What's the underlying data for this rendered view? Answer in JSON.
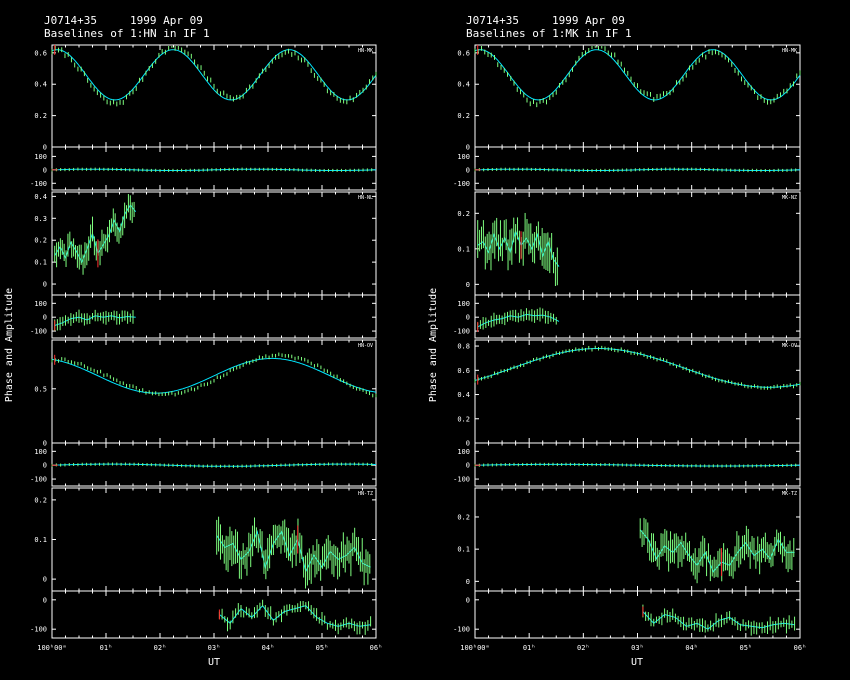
{
  "chart_data": [
    {
      "type": "line",
      "source": "J0714+35",
      "date": "1999 Apr 09",
      "subtitle": "Baselines of 1:HN in IF 1",
      "ylabel": "Phase and Amplitude",
      "xlabel": "UT",
      "x_ticks": [
        "100ʰ00ᵐ",
        "01ʰ",
        "02ʰ",
        "03ʰ",
        "04ʰ",
        "05ʰ",
        "06ʰ"
      ],
      "x_range_hours": [
        0,
        6
      ],
      "baselines": [
        {
          "name": "HN-MK",
          "amp_ylim": [
            0,
            0.65
          ],
          "amp_ticks": [
            0,
            0.2,
            0.4,
            0.6
          ],
          "phase_ylim": [
            -150,
            170
          ],
          "phase_ticks": [
            -100,
            0,
            100
          ],
          "model": {
            "base": 0.46,
            "amp": 0.16,
            "period_h": 2.15,
            "phase_rad": 1.3
          },
          "data_offset": -0.025,
          "noise": 0.015,
          "data_start_h": 0,
          "data_end_h": 6,
          "phase_model": {
            "amp": 5,
            "period_h": 3
          },
          "phase_noise": 3,
          "phase_extent_h": [
            0,
            6
          ]
        },
        {
          "name": "HN-NL",
          "amp_ylim": [
            -0.05,
            0.42
          ],
          "amp_ticks": [
            0,
            0.1,
            0.2,
            0.3,
            0.4
          ],
          "phase_ylim": [
            -150,
            160
          ],
          "phase_ticks": [
            -100,
            0,
            100
          ],
          "data": [
            [
              0.05,
              0.13
            ],
            [
              0.15,
              0.17
            ],
            [
              0.25,
              0.12
            ],
            [
              0.35,
              0.19
            ],
            [
              0.45,
              0.15
            ],
            [
              0.55,
              0.1
            ],
            [
              0.65,
              0.16
            ],
            [
              0.75,
              0.23
            ],
            [
              0.85,
              0.14
            ],
            [
              0.95,
              0.18
            ],
            [
              1.05,
              0.22
            ],
            [
              1.15,
              0.29
            ],
            [
              1.25,
              0.24
            ],
            [
              1.35,
              0.32
            ],
            [
              1.45,
              0.36
            ],
            [
              1.55,
              0.33
            ]
          ],
          "noise": 0.06,
          "phase_data": [
            [
              0.05,
              -60
            ],
            [
              0.2,
              -40
            ],
            [
              0.35,
              -10
            ],
            [
              0.5,
              0
            ],
            [
              0.65,
              -20
            ],
            [
              0.8,
              10
            ],
            [
              0.95,
              0
            ],
            [
              1.1,
              10
            ],
            [
              1.25,
              -5
            ],
            [
              1.4,
              5
            ],
            [
              1.55,
              0
            ]
          ],
          "phase_noise": 20
        },
        {
          "name": "HN-OV",
          "amp_ylim": [
            0,
            0.95
          ],
          "amp_ticks": [
            0,
            0.5
          ],
          "phase_ylim": [
            -150,
            160
          ],
          "phase_ticks": [
            -100,
            0,
            100
          ],
          "model": {
            "base": 0.62,
            "amp": 0.16,
            "period_h": 4.3,
            "phase_rad": 1.9
          },
          "data_offset": 0.04,
          "noise": 0.012,
          "data_start_h": 0,
          "data_end_h": 6,
          "phase_model": {
            "amp": 8,
            "period_h": 4.3
          },
          "phase_noise": 3,
          "phase_extent_h": [
            0,
            6
          ]
        },
        {
          "name": "HN-TZ",
          "amp_ylim": [
            -0.03,
            0.23
          ],
          "amp_ticks": [
            0,
            0.1,
            0.2
          ],
          "phase_ylim": [
            -130,
            30
          ],
          "phase_ticks": [
            -100,
            0
          ],
          "data": [
            [
              3.05,
              0.11
            ],
            [
              3.2,
              0.08
            ],
            [
              3.35,
              0.09
            ],
            [
              3.5,
              0.05
            ],
            [
              3.65,
              0.07
            ],
            [
              3.8,
              0.12
            ],
            [
              3.95,
              0.03
            ],
            [
              4.1,
              0.09
            ],
            [
              4.25,
              0.12
            ],
            [
              4.4,
              0.06
            ],
            [
              4.55,
              0.1
            ],
            [
              4.7,
              0.02
            ],
            [
              4.85,
              0.06
            ],
            [
              5.0,
              0.03
            ],
            [
              5.15,
              0.07
            ],
            [
              5.3,
              0.05
            ],
            [
              5.45,
              0.06
            ],
            [
              5.6,
              0.08
            ],
            [
              5.75,
              0.04
            ],
            [
              5.9,
              0.03
            ]
          ],
          "noise": 0.045,
          "phase_data": [
            [
              3.1,
              -50
            ],
            [
              3.3,
              -80
            ],
            [
              3.5,
              -30
            ],
            [
              3.7,
              -60
            ],
            [
              3.9,
              -20
            ],
            [
              4.1,
              -70
            ],
            [
              4.3,
              -40
            ],
            [
              4.5,
              -30
            ],
            [
              4.7,
              -20
            ],
            [
              4.9,
              -60
            ],
            [
              5.1,
              -80
            ],
            [
              5.3,
              -90
            ],
            [
              5.5,
              -80
            ],
            [
              5.7,
              -90
            ],
            [
              5.9,
              -85
            ]
          ],
          "phase_noise": 25
        }
      ]
    },
    {
      "type": "line",
      "source": "J0714+35",
      "date": "1999 Apr 09",
      "subtitle": "Baselines of 1:MK in IF 1",
      "ylabel": "Phase and Amplitude",
      "xlabel": "UT",
      "x_ticks": [
        "100ʰ00ᵐ",
        "01ʰ",
        "02ʰ",
        "03ʰ",
        "04ʰ",
        "05ʰ",
        "06ʰ"
      ],
      "x_range_hours": [
        0,
        6
      ],
      "baselines": [
        {
          "name": "HN-MK",
          "amp_ylim": [
            0,
            0.65
          ],
          "amp_ticks": [
            0,
            0.2,
            0.4,
            0.6
          ],
          "phase_ylim": [
            -150,
            170
          ],
          "phase_ticks": [
            -100,
            0,
            100
          ],
          "model": {
            "base": 0.46,
            "amp": 0.16,
            "period_h": 2.15,
            "phase_rad": 1.3
          },
          "data_offset": -0.025,
          "noise": 0.015,
          "data_start_h": 0,
          "data_end_h": 6,
          "phase_model": {
            "amp": 5,
            "period_h": 3
          },
          "phase_noise": 3,
          "phase_extent_h": [
            0,
            6
          ]
        },
        {
          "name": "MK-NZ",
          "amp_ylim": [
            -0.03,
            0.26
          ],
          "amp_ticks": [
            0,
            0.1,
            0.2
          ],
          "phase_ylim": [
            -150,
            160
          ],
          "phase_ticks": [
            -100,
            0,
            100
          ],
          "data": [
            [
              0.05,
              0.11
            ],
            [
              0.15,
              0.12
            ],
            [
              0.25,
              0.09
            ],
            [
              0.35,
              0.14
            ],
            [
              0.45,
              0.1
            ],
            [
              0.55,
              0.13
            ],
            [
              0.65,
              0.09
            ],
            [
              0.75,
              0.15
            ],
            [
              0.85,
              0.11
            ],
            [
              0.95,
              0.13
            ],
            [
              1.05,
              0.1
            ],
            [
              1.15,
              0.14
            ],
            [
              1.25,
              0.08
            ],
            [
              1.35,
              0.12
            ],
            [
              1.45,
              0.07
            ],
            [
              1.55,
              0.05
            ]
          ],
          "noise": 0.055,
          "phase_data": [
            [
              0.05,
              -70
            ],
            [
              0.2,
              -40
            ],
            [
              0.35,
              -20
            ],
            [
              0.5,
              -10
            ],
            [
              0.65,
              10
            ],
            [
              0.8,
              0
            ],
            [
              0.95,
              20
            ],
            [
              1.1,
              10
            ],
            [
              1.25,
              15
            ],
            [
              1.4,
              0
            ],
            [
              1.55,
              -30
            ]
          ],
          "phase_noise": 25
        },
        {
          "name": "MK-OV",
          "amp_ylim": [
            0,
            0.85
          ],
          "amp_ticks": [
            0,
            0.2,
            0.4,
            0.6,
            0.8
          ],
          "phase_ylim": [
            -150,
            160
          ],
          "phase_ticks": [
            -100,
            0,
            100
          ],
          "model": {
            "base": 0.62,
            "amp": 0.16,
            "period_h": 6.3,
            "phase_rad": -0.7
          },
          "data_offset": 0,
          "noise": 0.01,
          "data_start_h": 0,
          "data_end_h": 6,
          "phase_model": {
            "amp": 6,
            "period_h": 6
          },
          "phase_noise": 3,
          "phase_extent_h": [
            0,
            6
          ]
        },
        {
          "name": "MK-TZ",
          "amp_ylim": [
            -0.03,
            0.29
          ],
          "amp_ticks": [
            0,
            0.1,
            0.2
          ],
          "phase_ylim": [
            -130,
            30
          ],
          "phase_ticks": [
            -100,
            0
          ],
          "data": [
            [
              3.05,
              0.16
            ],
            [
              3.2,
              0.13
            ],
            [
              3.35,
              0.07
            ],
            [
              3.5,
              0.11
            ],
            [
              3.65,
              0.09
            ],
            [
              3.8,
              0.12
            ],
            [
              3.95,
              0.08
            ],
            [
              4.1,
              0.05
            ],
            [
              4.25,
              0.09
            ],
            [
              4.4,
              0.03
            ],
            [
              4.55,
              0.06
            ],
            [
              4.7,
              0.05
            ],
            [
              4.85,
              0.09
            ],
            [
              5.0,
              0.12
            ],
            [
              5.15,
              0.08
            ],
            [
              5.3,
              0.1
            ],
            [
              5.45,
              0.07
            ],
            [
              5.6,
              0.13
            ],
            [
              5.75,
              0.09
            ],
            [
              5.9,
              0.09
            ]
          ],
          "noise": 0.05,
          "phase_data": [
            [
              3.1,
              -40
            ],
            [
              3.3,
              -80
            ],
            [
              3.5,
              -50
            ],
            [
              3.7,
              -60
            ],
            [
              3.9,
              -90
            ],
            [
              4.1,
              -80
            ],
            [
              4.3,
              -100
            ],
            [
              4.5,
              -70
            ],
            [
              4.7,
              -60
            ],
            [
              4.9,
              -85
            ],
            [
              5.1,
              -90
            ],
            [
              5.3,
              -95
            ],
            [
              5.5,
              -85
            ],
            [
              5.7,
              -80
            ],
            [
              5.9,
              -85
            ]
          ],
          "phase_noise": 20
        }
      ]
    }
  ],
  "colors": {
    "background": "#000000",
    "frame": "#ffffff",
    "model": "#00e6ff",
    "data": "#7fff7f",
    "flag": "#ff3030"
  }
}
